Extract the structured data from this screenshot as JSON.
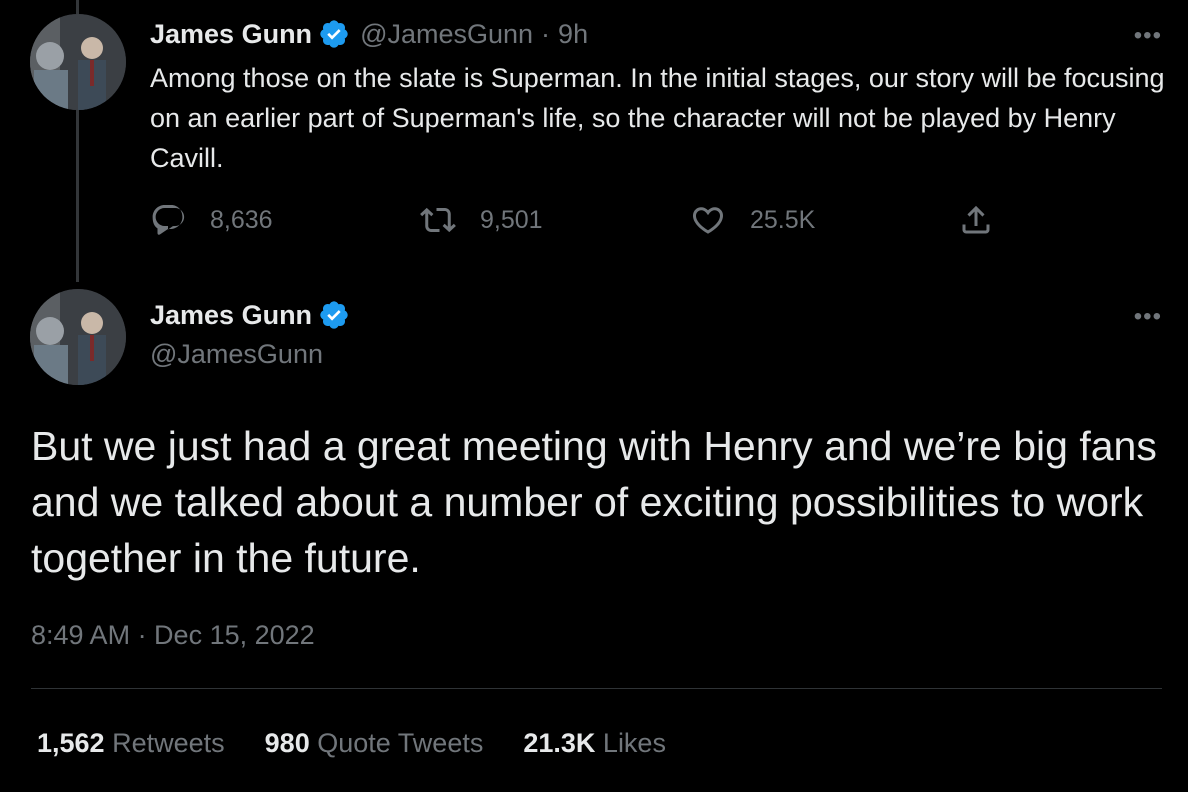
{
  "tweet1": {
    "author_name": "James Gunn",
    "handle": "@JamesGunn",
    "separator": "·",
    "time": "9h",
    "more": "•••",
    "text": "Among those on the slate is Superman. In the initial stages, our story will be focusing on an earlier part of Superman's life, so the character will not be played by Henry Cavill.",
    "replies": "8,636",
    "retweets": "9,501",
    "likes": "25.5K"
  },
  "tweet2": {
    "author_name": "James Gunn",
    "handle": "@JamesGunn",
    "more": "•••",
    "text": "But we just had a great meeting with Henry and we’re big fans and we talked about a number of exciting possibilities to work together in the future.",
    "timestamp": "8:49 AM · Dec 15, 2022",
    "stats": {
      "retweets_count": "1,562",
      "retweets_label": "Retweets",
      "quotes_count": "980",
      "quotes_label": "Quote Tweets",
      "likes_count": "21.3K",
      "likes_label": "Likes"
    }
  },
  "colors": {
    "background": "#000000",
    "text": "#e7e9ea",
    "muted": "#71767b",
    "verified": "#1d9bf0"
  },
  "icons": [
    "verified-badge-icon",
    "reply-icon",
    "retweet-icon",
    "like-icon",
    "share-icon",
    "more-icon"
  ]
}
